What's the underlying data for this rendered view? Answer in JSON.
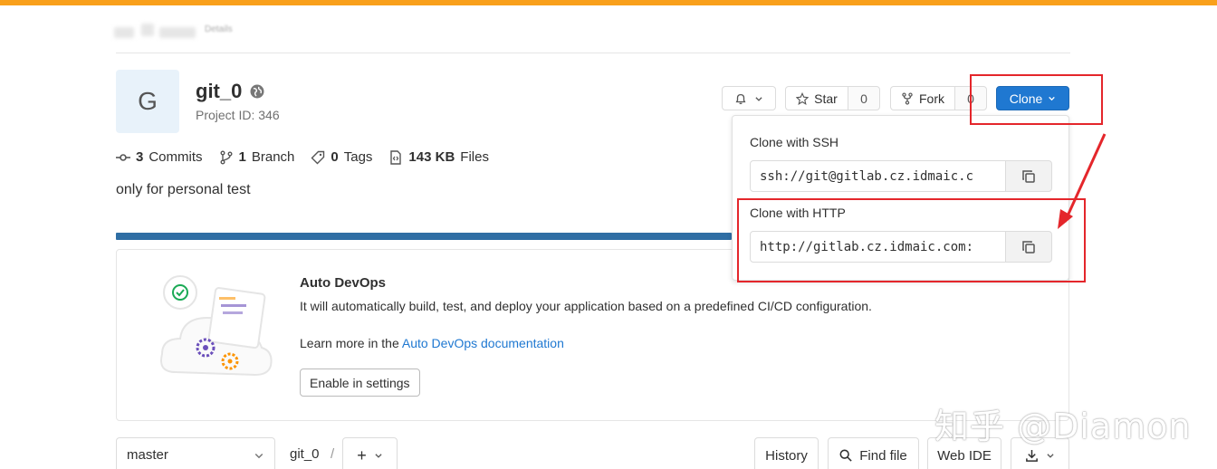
{
  "header": {
    "accent_color": "#f9a01b",
    "breadcrumb_text": "Details"
  },
  "project": {
    "avatar_letter": "G",
    "title": "git_0",
    "id_label": "Project ID: 346",
    "description": "only for personal test",
    "visibility_icon": "globe-icon"
  },
  "stats": {
    "commits_count": "3",
    "commits_label": "Commits",
    "branch_count": "1",
    "branch_label": "Branch",
    "tags_count": "0",
    "tags_label": "Tags",
    "files_size": "143 KB",
    "files_label": "Files"
  },
  "actions": {
    "notification_icon": "bell-icon",
    "star_label": "Star",
    "star_count": "0",
    "fork_label": "Fork",
    "fork_count": "0",
    "clone_label": "Clone",
    "clone_color": "#1f78d1"
  },
  "clone_dropdown": {
    "ssh_label": "Clone with SSH",
    "ssh_url": "ssh://git@gitlab.cz.idmaic.c",
    "http_label": "Clone with HTTP",
    "http_url": "http://gitlab.cz.idmaic.com:"
  },
  "devops": {
    "title": "Auto DevOps",
    "description": "It will automatically build, test, and deploy your application based on a predefined CI/CD configuration.",
    "learn_prefix": "Learn more in the ",
    "learn_link": "Auto DevOps documentation",
    "enable_button": "Enable in settings"
  },
  "file_bar": {
    "branch": "master",
    "path": "git_0",
    "separator": "/",
    "add_label": "+",
    "history": "History",
    "find_file": "Find file",
    "web_ide": "Web IDE"
  },
  "annotations": {
    "highlight_color": "#e4262b"
  },
  "watermark": "知乎 @Diamon"
}
